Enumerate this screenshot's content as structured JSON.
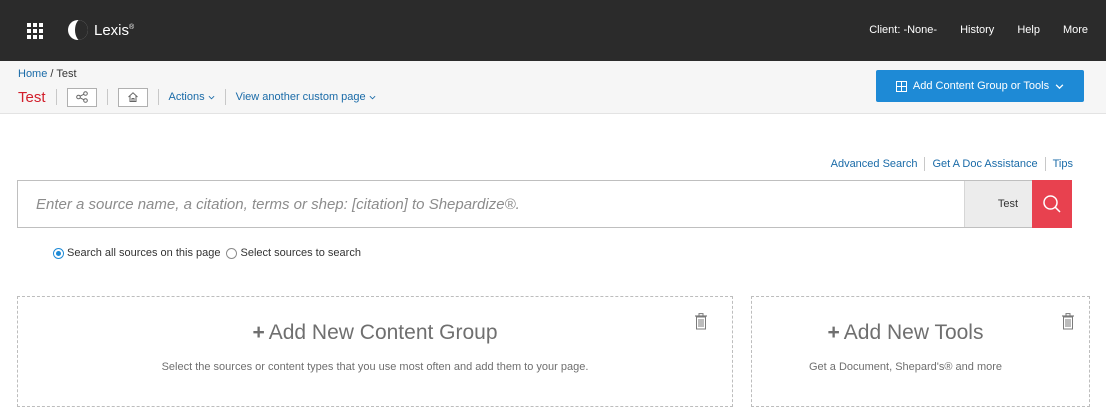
{
  "topbar": {
    "brand": "Lexis",
    "brand_mark": "®",
    "nav": [
      "Client: -None-",
      "History",
      "Help",
      "More"
    ]
  },
  "breadcrumb": {
    "home": "Home",
    "separator": " / ",
    "current": "Test"
  },
  "page": {
    "title": "Test",
    "actions_label": "Actions",
    "view_other_label": "View another custom page"
  },
  "add_button": {
    "label": "Add Content Group or Tools"
  },
  "search_links": [
    "Advanced Search",
    "Get A Doc Assistance",
    "Tips"
  ],
  "search": {
    "placeholder": "Enter a source name, a citation, terms or shep: [citation] to Shepardize®.",
    "scope": "Test"
  },
  "radio_options": [
    {
      "label": "Search all sources on this page",
      "selected": true
    },
    {
      "label": "Select sources to search",
      "selected": false
    }
  ],
  "panels": {
    "content_group": {
      "title": "Add New Content Group",
      "desc": "Select the sources or content types that you use most often and add them to your page."
    },
    "tools": {
      "title": "Add New Tools",
      "desc": "Get a Document, Shepard's® and more"
    }
  },
  "colors": {
    "topbar": "#2b2b2b",
    "accent_blue": "#1e8ad6",
    "title_red": "#d21e2b",
    "search_red": "#e8414f"
  }
}
